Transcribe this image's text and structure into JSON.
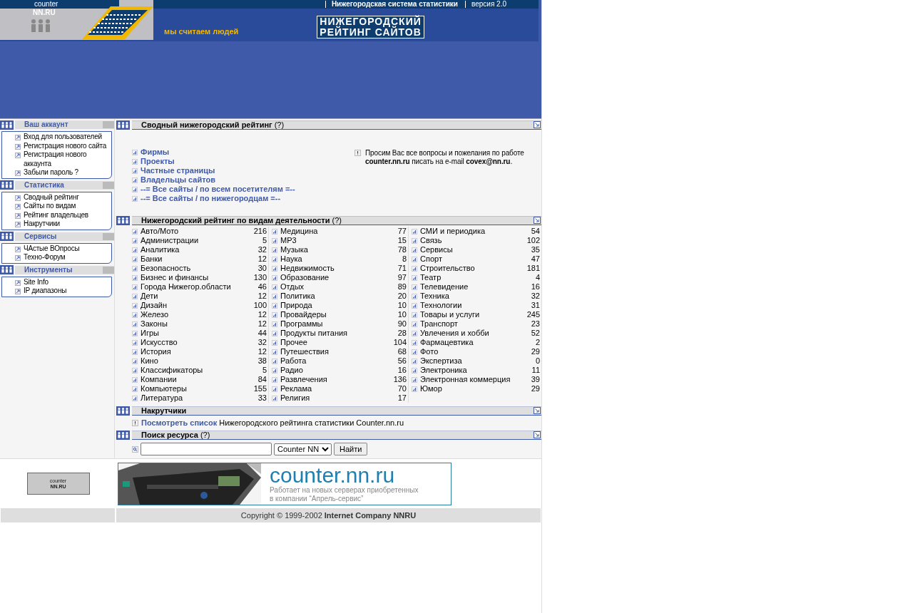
{
  "header": {
    "logo": [
      "counter",
      "NN.RU"
    ],
    "top_bar": [
      "Нижегородская система статистики",
      "версия 2.0"
    ],
    "slogan": "мы считаем людей",
    "title": [
      "НИЖЕГОРОДСКИЙ",
      "РЕЙТИНГ САЙТОВ"
    ]
  },
  "sidebar": {
    "sections": [
      {
        "title": "Ваш аккаунт",
        "items": [
          "Вход для пользователей",
          "Регистрация нового сайта",
          "Регистрация нового аккаунта",
          "Забыли пароль ?"
        ]
      },
      {
        "title": "Статистика",
        "items": [
          "Сводный рейтинг",
          "Сайты по видам",
          "Рейтинг владельцев",
          "Накрутчики"
        ]
      },
      {
        "title": "Сервисы",
        "items": [
          "ЧАстые ВОпросы",
          "Техно-Форум"
        ]
      },
      {
        "title": "Инструменты",
        "items": [
          "Site Info",
          "IP диапазоны"
        ]
      }
    ]
  },
  "summary": {
    "title": "Сводный нижегородский рейтинг",
    "help": "(?)",
    "links": [
      "Фирмы",
      "Проекты",
      "Частные страницы",
      "Владельцы сайтов",
      "--= Все сайты / по всем посетителям =--",
      "--= Все сайты / по нижегородцам =--"
    ],
    "notice": "Просим Вас все вопросы и пожелания по работе **counter.nn.ru** писать на e-mail **covex@nn.ru**."
  },
  "categories": {
    "title": "Нижегородский рейтинг по видам деятельности",
    "help": "(?)",
    "columns": [
      [
        {
          "name": "Авто/Мото",
          "count": "216"
        },
        {
          "name": "Администрации",
          "count": "5"
        },
        {
          "name": "Аналитика",
          "count": "32"
        },
        {
          "name": "Банки",
          "count": "12"
        },
        {
          "name": "Безопасность",
          "count": "30"
        },
        {
          "name": "Бизнес и финансы",
          "count": "130"
        },
        {
          "name": "Города Нижегор.области",
          "count": "46"
        },
        {
          "name": "Дети",
          "count": "12"
        },
        {
          "name": "Дизайн",
          "count": "100"
        },
        {
          "name": "Железо",
          "count": "12"
        },
        {
          "name": "Законы",
          "count": "12"
        },
        {
          "name": "Игры",
          "count": "44"
        },
        {
          "name": "Искусство",
          "count": "32"
        },
        {
          "name": "История",
          "count": "12"
        },
        {
          "name": "Кино",
          "count": "38"
        },
        {
          "name": "Классификаторы",
          "count": "5"
        },
        {
          "name": "Компании",
          "count": "84"
        },
        {
          "name": "Компьютеры",
          "count": "155"
        },
        {
          "name": "Литература",
          "count": "33"
        }
      ],
      [
        {
          "name": "Медицина",
          "count": "77"
        },
        {
          "name": "MP3",
          "count": "15"
        },
        {
          "name": "Музыка",
          "count": "78"
        },
        {
          "name": "Наука",
          "count": "8"
        },
        {
          "name": "Недвижимость",
          "count": "71"
        },
        {
          "name": "Образование",
          "count": "97"
        },
        {
          "name": "Отдых",
          "count": "89"
        },
        {
          "name": "Политика",
          "count": "20"
        },
        {
          "name": "Природа",
          "count": "10"
        },
        {
          "name": "Провайдеры",
          "count": "10"
        },
        {
          "name": "Программы",
          "count": "90"
        },
        {
          "name": "Продукты питания",
          "count": "28"
        },
        {
          "name": "Прочее",
          "count": "104"
        },
        {
          "name": "Путешествия",
          "count": "68"
        },
        {
          "name": "Работа",
          "count": "56"
        },
        {
          "name": "Радио",
          "count": "16"
        },
        {
          "name": "Развлечения",
          "count": "136"
        },
        {
          "name": "Реклама",
          "count": "70"
        },
        {
          "name": "Религия",
          "count": "17"
        }
      ],
      [
        {
          "name": "СМИ и периодика",
          "count": "54"
        },
        {
          "name": "Связь",
          "count": "102"
        },
        {
          "name": "Сервисы",
          "count": "35"
        },
        {
          "name": "Спорт",
          "count": "47"
        },
        {
          "name": "Строительство",
          "count": "181"
        },
        {
          "name": "Театр",
          "count": "4"
        },
        {
          "name": "Телевидение",
          "count": "16"
        },
        {
          "name": "Техника",
          "count": "32"
        },
        {
          "name": "Технологии",
          "count": "31"
        },
        {
          "name": "Товары и услуги",
          "count": "245"
        },
        {
          "name": "Транспорт",
          "count": "23"
        },
        {
          "name": "Увлечения и хобби",
          "count": "52"
        },
        {
          "name": "Фармацевтика",
          "count": "2"
        },
        {
          "name": "Фото",
          "count": "29"
        },
        {
          "name": "Экспертиза",
          "count": "0"
        },
        {
          "name": "Электроника",
          "count": "11"
        },
        {
          "name": "Электронная коммерция",
          "count": "39"
        },
        {
          "name": "Юмор",
          "count": "29"
        }
      ]
    ]
  },
  "cheaters": {
    "title": "Накрутчики",
    "link": "Посмотреть список",
    "text": "Нижегородского рейтинга статистики Counter.nn.ru"
  },
  "search": {
    "title": "Поиск ресурса",
    "help": "(?)",
    "select": "Counter NN",
    "button": "Найти"
  },
  "footer": {
    "badge": [
      "counter",
      "NN.RU"
    ],
    "banner": {
      "domain": "counter.nn.ru",
      "lines": [
        "Работает на новых серверах приобретенных",
        "в компании “Апрель-сервис”"
      ]
    },
    "copyright": "Copyright © 1999-2002 **Internet Company NNRU**"
  }
}
